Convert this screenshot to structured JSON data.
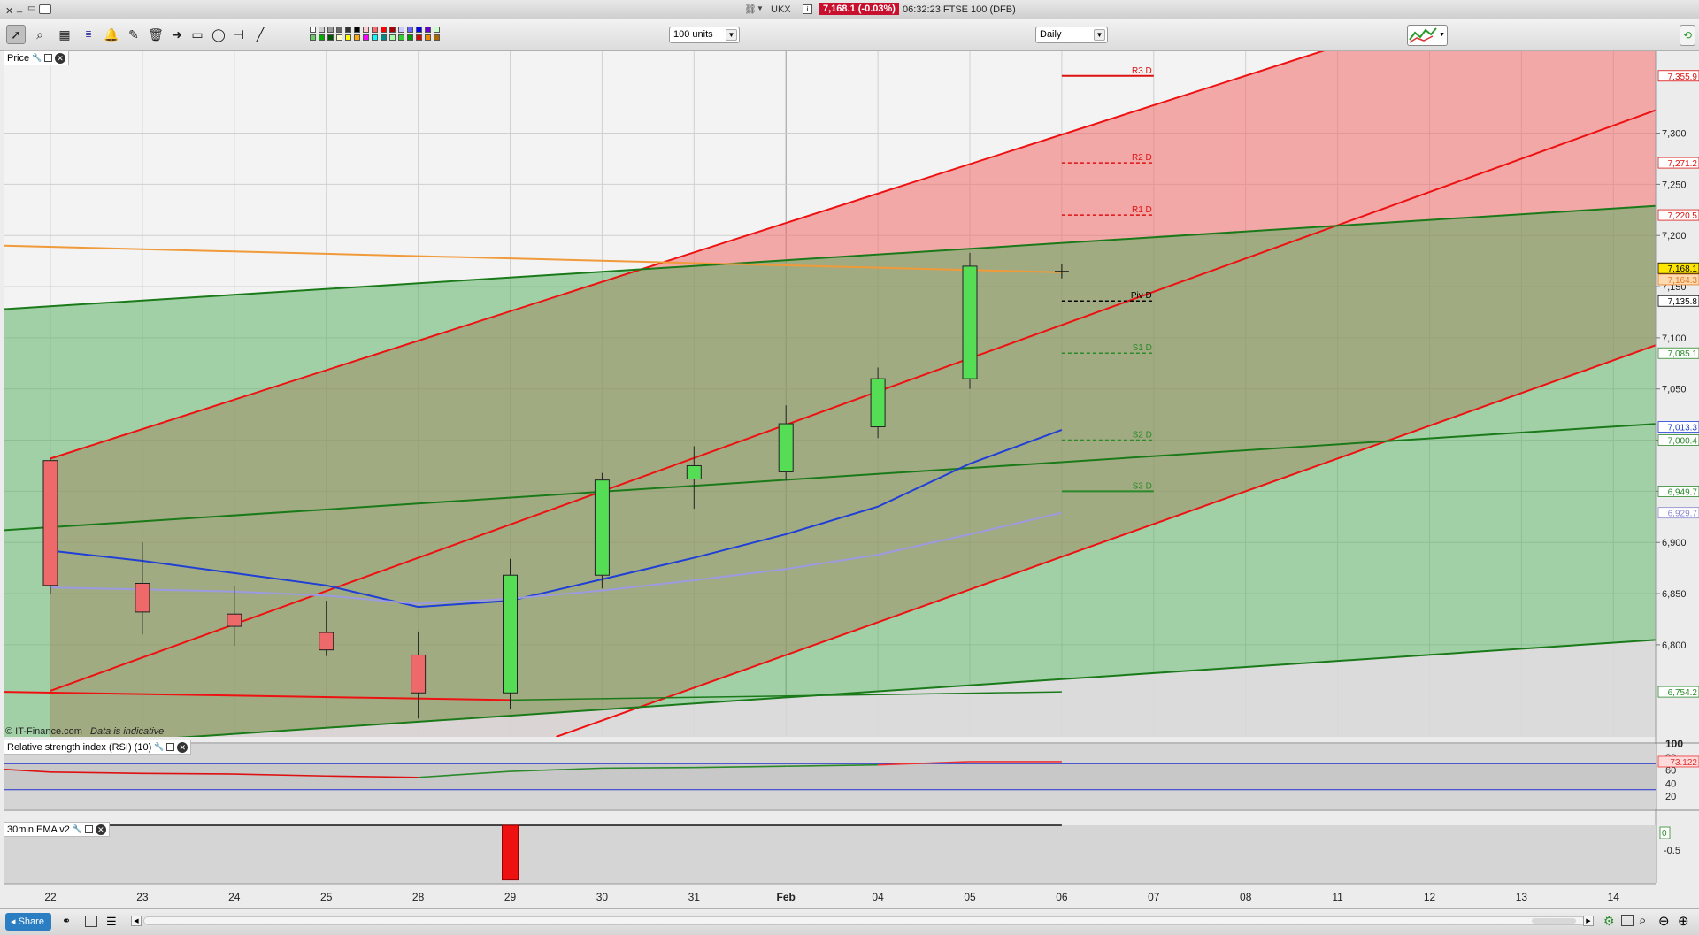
{
  "window": {
    "symbol": "UKX",
    "price_badge": "7,168.1 (-0.03%)",
    "time_title": "06:32:23 FTSE 100 (DFB)"
  },
  "toolbar": {
    "units_value": "100 units",
    "interval_value": "Daily"
  },
  "price_panel": {
    "label": "Price",
    "copyright": "© IT-Finance.com",
    "disclaimer": "Data is indicative"
  },
  "rsi_panel": {
    "label": "Relative strength index (RSI) (10)",
    "value_tag": "73.122",
    "ticks": [
      "100",
      "80",
      "60",
      "40",
      "20"
    ]
  },
  "ema_panel": {
    "label": "30min EMA v2",
    "value_tag": "0",
    "tick": "-0.5"
  },
  "statusbar": {
    "share_label": "Share"
  },
  "colors": {
    "bull": "#55dd55",
    "bear": "#ee6a6a",
    "red_line": "#ee1111",
    "green_line": "#1a7a1a",
    "blue_ma": "#1f3fd6",
    "violet_ma": "#9c9ae0",
    "orange_line": "#f09a3a"
  },
  "chart_data": {
    "type": "candlestick",
    "x_labels": [
      "22",
      "23",
      "24",
      "25",
      "28",
      "29",
      "30",
      "31",
      "Feb",
      "04",
      "05",
      "06",
      "07",
      "08",
      "11",
      "12",
      "13",
      "14"
    ],
    "ylim": [
      6710,
      7380
    ],
    "y_ticks": [
      "7,300",
      "7,250",
      "7,200",
      "7,150",
      "7,100",
      "7,050",
      "7,000",
      "6,950",
      "6,900",
      "6,850",
      "6,800"
    ],
    "candles": [
      {
        "x": "22",
        "open": 6980,
        "high": 6982,
        "low": 6850,
        "close": 6858
      },
      {
        "x": "23",
        "open": 6860,
        "high": 6900,
        "low": 6810,
        "close": 6832
      },
      {
        "x": "24",
        "open": 6830,
        "high": 6857,
        "low": 6799,
        "close": 6818
      },
      {
        "x": "25",
        "open": 6812,
        "high": 6843,
        "low": 6789,
        "close": 6795
      },
      {
        "x": "28",
        "open": 6790,
        "high": 6813,
        "low": 6728,
        "close": 6753
      },
      {
        "x": "29",
        "open": 6753,
        "high": 6884,
        "low": 6737,
        "close": 6868
      },
      {
        "x": "30",
        "open": 6868,
        "high": 6968,
        "low": 6855,
        "close": 6961
      },
      {
        "x": "31",
        "open": 6962,
        "high": 6994,
        "low": 6933,
        "close": 6975
      },
      {
        "x": "Feb",
        "open": 6969,
        "high": 7034,
        "low": 6961,
        "close": 7016
      },
      {
        "x": "04",
        "open": 7013,
        "high": 7071,
        "low": 7002,
        "close": 7060
      },
      {
        "x": "05",
        "open": 7060,
        "high": 7183,
        "low": 7050,
        "close": 7170
      }
    ],
    "moving_averages": [
      {
        "name": "blue",
        "values": [
          [
            0,
            6892
          ],
          [
            1,
            6882
          ],
          [
            2,
            6870
          ],
          [
            3,
            6858
          ],
          [
            4,
            6837
          ],
          [
            5,
            6843
          ],
          [
            6,
            6864
          ],
          [
            7,
            6885
          ],
          [
            8,
            6908
          ],
          [
            9,
            6935
          ],
          [
            10,
            6977
          ],
          [
            11,
            7010
          ]
        ]
      },
      {
        "name": "violet",
        "values": [
          [
            0,
            6856
          ],
          [
            1,
            6854
          ],
          [
            2,
            6852
          ],
          [
            3,
            6848
          ],
          [
            4,
            6840
          ],
          [
            5,
            6845
          ],
          [
            6,
            6853
          ],
          [
            7,
            6863
          ],
          [
            8,
            6874
          ],
          [
            9,
            6888
          ],
          [
            10,
            6908
          ],
          [
            11,
            6929
          ]
        ]
      }
    ],
    "orange_line": [
      [
        -0.5,
        7190
      ],
      [
        11,
        7164
      ]
    ],
    "red_bottom_line": [
      [
        -0.5,
        6754
      ],
      [
        5,
        6746
      ]
    ],
    "green_bottom_line": [
      [
        5,
        6746
      ],
      [
        11,
        6754
      ]
    ],
    "pivots": [
      {
        "label": "R3 D",
        "value": 7356,
        "tag": "7,355.9",
        "color": "#dd1111",
        "style": "solid"
      },
      {
        "label": "R2 D",
        "value": 7271,
        "tag": "7,271.2",
        "color": "#dd1111",
        "style": "dashed"
      },
      {
        "label": "R1 D",
        "value": 7220,
        "tag": "7,220.5",
        "color": "#dd1111",
        "style": "dashed"
      },
      {
        "label": "Piv D",
        "value": 7136,
        "tag": "7,135.8",
        "color": "#000000",
        "style": "dashed"
      },
      {
        "label": "S1 D",
        "value": 7085,
        "tag": "7,085.1",
        "color": "#2a8a2a",
        "style": "dashed"
      },
      {
        "label": "S2 D",
        "value": 7000,
        "tag": "7,000.4",
        "color": "#2a8a2a",
        "style": "dashed"
      },
      {
        "label": "S3 D",
        "value": 6950,
        "tag": "6,949.7",
        "color": "#2a8a2a",
        "style": "solid"
      }
    ],
    "price_tags": [
      {
        "tag": "7,168.1",
        "value": 7168,
        "bg": "#ffe600",
        "fg": "#000000"
      },
      {
        "tag": "7,164.3",
        "value": 7157,
        "bg": "#ffd9b0",
        "fg": "#e07a20"
      },
      {
        "tag": "7,013.3",
        "value": 7013,
        "bg": "#ffffff",
        "fg": "#1f3fd6"
      },
      {
        "tag": "6,929.7",
        "value": 6929,
        "bg": "#ffffff",
        "fg": "#8a88d0"
      },
      {
        "tag": "6,754.2",
        "value": 6754,
        "bg": "#ffffff",
        "fg": "#2a8a2a"
      }
    ],
    "channels": [
      {
        "name": "red",
        "color": "#ee1111",
        "lines": [
          [
            [
              0,
              6982
            ],
            [
              18,
              7500
            ]
          ],
          [
            [
              0,
              6755
            ],
            [
              18,
              7340
            ]
          ],
          [
            [
              5.5,
              6710
            ],
            [
              18,
              7110
            ]
          ]
        ]
      },
      {
        "name": "green",
        "color": "#1a7a1a",
        "lines": [
          [
            [
              -0.5,
              7128
            ],
            [
              18,
              7232
            ]
          ],
          [
            [
              -0.5,
              6912
            ],
            [
              18,
              7019
            ]
          ],
          [
            [
              -0.5,
              6698
            ],
            [
              18,
              6808
            ]
          ]
        ]
      }
    ],
    "rsi": {
      "ylim": [
        0,
        100
      ],
      "levels": [
        70,
        30
      ],
      "values": [
        [
          -0.5,
          61
        ],
        [
          0,
          57
        ],
        [
          1,
          55
        ],
        [
          2,
          54
        ],
        [
          3,
          51
        ],
        [
          4,
          49
        ],
        [
          5,
          58
        ],
        [
          6,
          63
        ],
        [
          7,
          64
        ],
        [
          8,
          66
        ],
        [
          9,
          68
        ],
        [
          10,
          73
        ],
        [
          11,
          73
        ]
      ]
    },
    "ema_histogram": [
      {
        "x": "29",
        "value": -1.1
      }
    ]
  }
}
